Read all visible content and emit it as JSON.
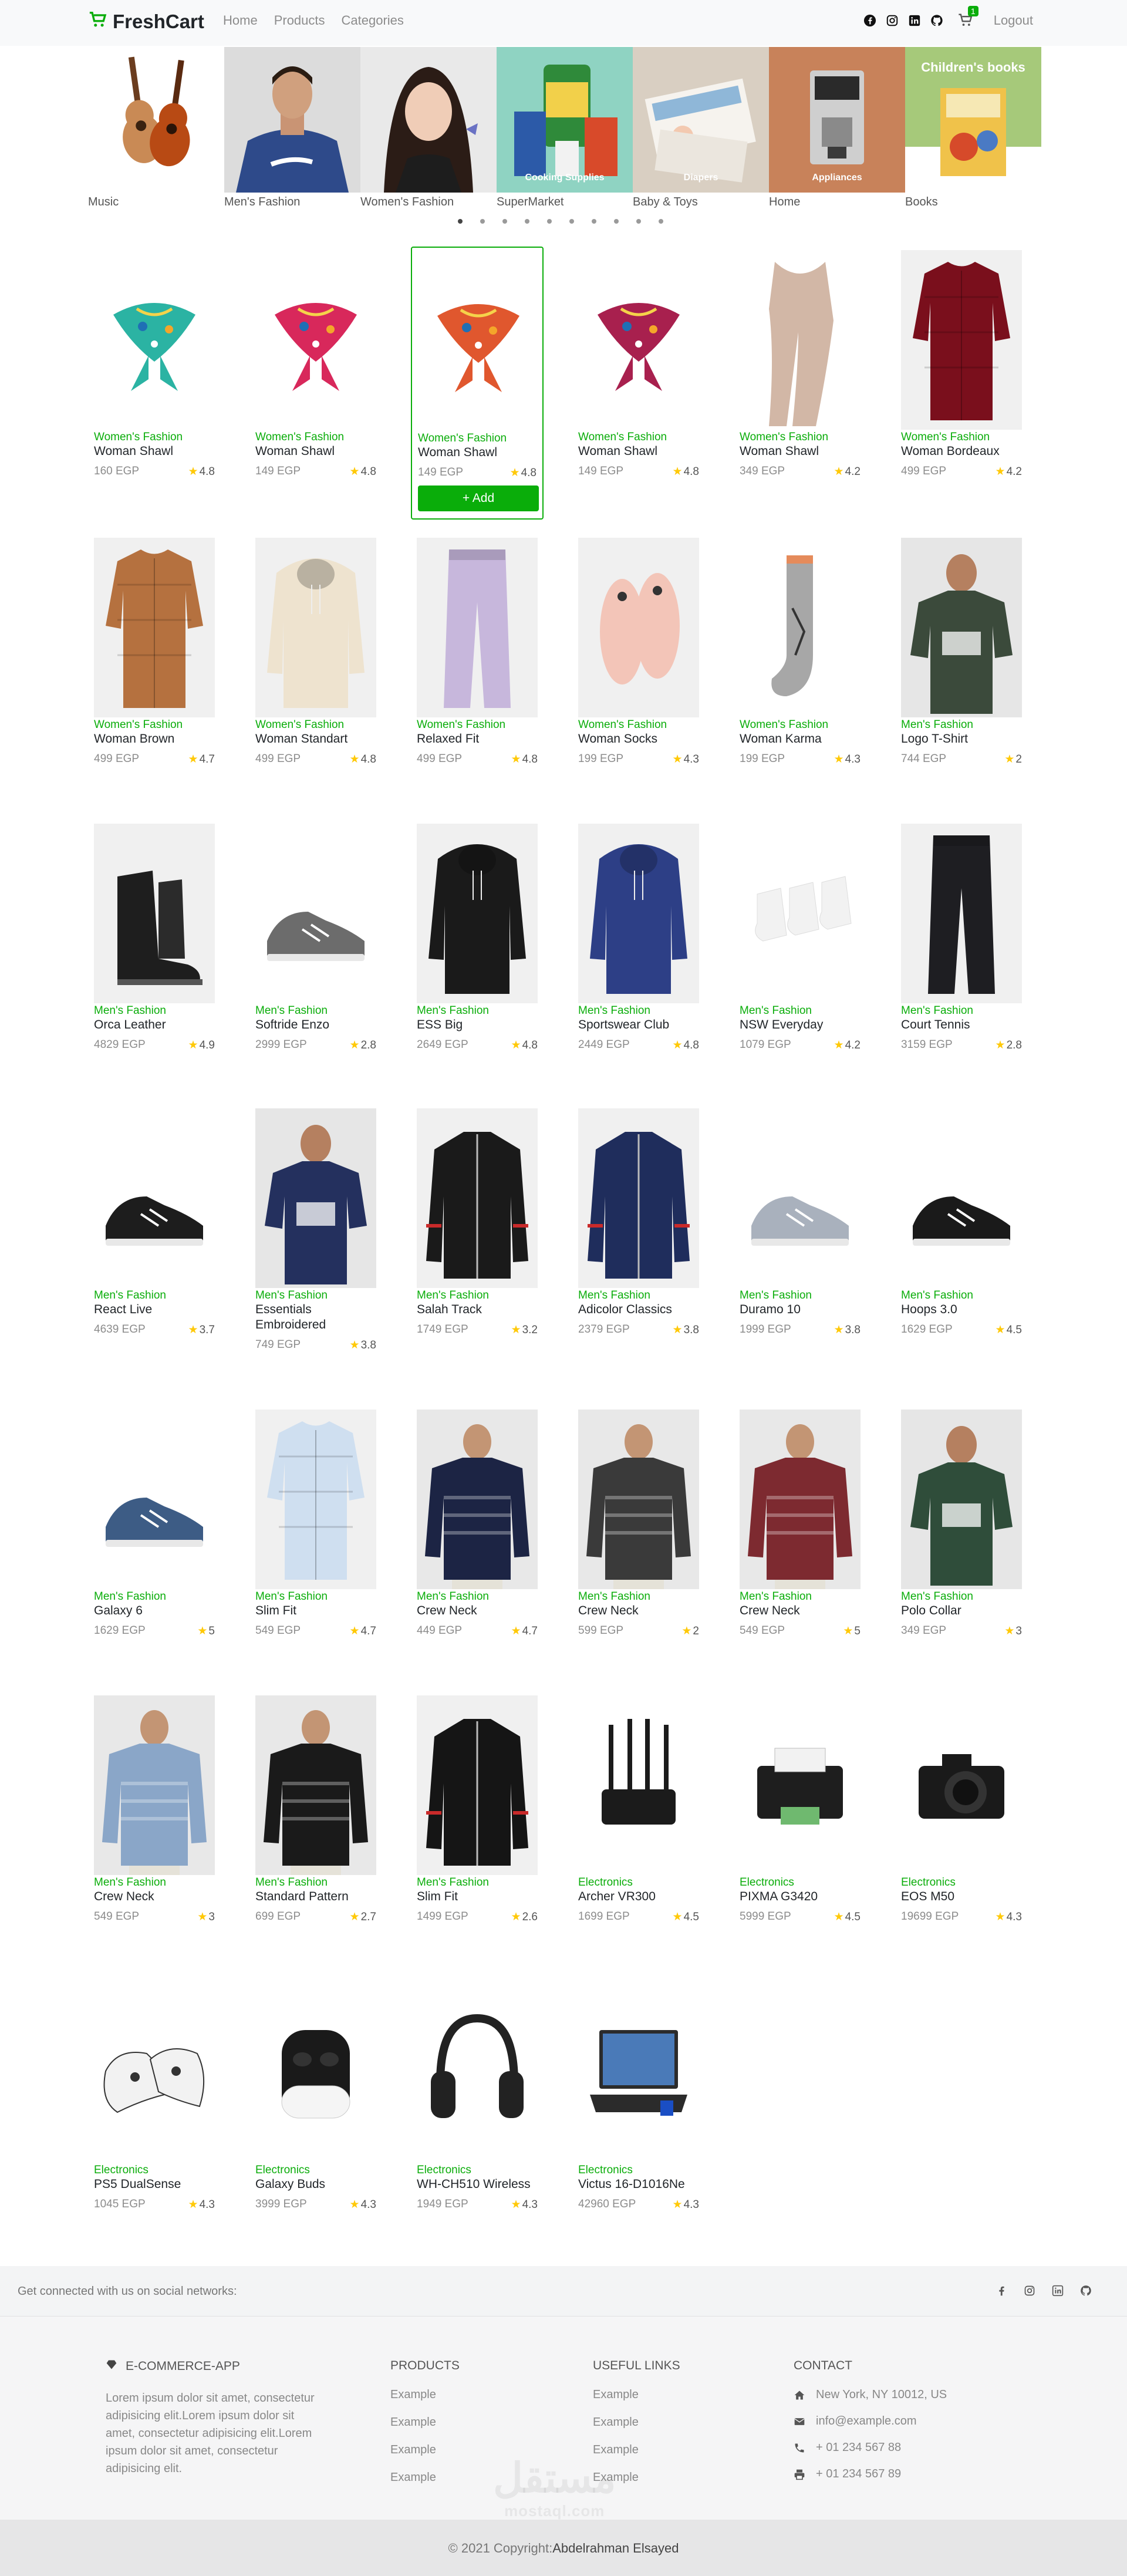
{
  "navbar": {
    "brand": "FreshCart",
    "links": [
      "Home",
      "Products",
      "Categories"
    ],
    "cart_count": "1",
    "logout": "Logout"
  },
  "slider": {
    "slides": [
      {
        "caption": "Music",
        "overlay": ""
      },
      {
        "caption": "Men's Fashion",
        "overlay": ""
      },
      {
        "caption": "Women's Fashion",
        "overlay": ""
      },
      {
        "caption": "SuperMarket",
        "overlay": "Cooking Supplies"
      },
      {
        "caption": "Baby & Toys",
        "overlay": "Diapers"
      },
      {
        "caption": "Home",
        "overlay": "Appliances"
      },
      {
        "caption": "Books",
        "overlay": "Children's books"
      }
    ],
    "dots": 10,
    "active_dot": 0
  },
  "add_label": "+ Add",
  "products": [
    {
      "category": "Women's Fashion",
      "title": "Woman Shawl",
      "price": "160 EGP",
      "rating": "4.8",
      "kind": "shawl",
      "color": "#2bb3a3"
    },
    {
      "category": "Women's Fashion",
      "title": "Woman Shawl",
      "price": "149 EGP",
      "rating": "4.8",
      "kind": "shawl",
      "color": "#d8285b"
    },
    {
      "category": "Women's Fashion",
      "title": "Woman Shawl",
      "price": "149 EGP",
      "rating": "4.8",
      "kind": "shawl",
      "color": "#e0572e"
    },
    {
      "category": "Women's Fashion",
      "title": "Woman Shawl",
      "price": "149 EGP",
      "rating": "4.8",
      "kind": "shawl",
      "color": "#a8204e"
    },
    {
      "category": "Women's Fashion",
      "title": "Woman Shawl",
      "price": "349 EGP",
      "rating": "4.2",
      "kind": "scarf",
      "color": "#d2b7a6"
    },
    {
      "category": "Women's Fashion",
      "title": "Woman Bordeaux",
      "price": "499 EGP",
      "rating": "4.2",
      "kind": "shirt",
      "color": "#7a0f1c"
    },
    {
      "category": "Women's Fashion",
      "title": "Woman Brown",
      "price": "499 EGP",
      "rating": "4.7",
      "kind": "shirt",
      "color": "#b5713f"
    },
    {
      "category": "Women's Fashion",
      "title": "Woman Standart",
      "price": "499 EGP",
      "rating": "4.8",
      "kind": "hoodie",
      "color": "#eee3cf"
    },
    {
      "category": "Women's Fashion",
      "title": "Relaxed Fit",
      "price": "499 EGP",
      "rating": "4.8",
      "kind": "pants",
      "color": "#c7b7dc"
    },
    {
      "category": "Women's Fashion",
      "title": "Woman Socks",
      "price": "199 EGP",
      "rating": "4.3",
      "kind": "slippers",
      "color": "#f3c5b8"
    },
    {
      "category": "Women's Fashion",
      "title": "Woman Karma",
      "price": "199 EGP",
      "rating": "4.3",
      "kind": "sock",
      "color": "#a7a7a7"
    },
    {
      "category": "Men's Fashion",
      "title": "Logo T-Shirt",
      "price": "744 EGP",
      "rating": "2",
      "kind": "tshirt",
      "color": "#3b4a3b"
    },
    {
      "category": "Men's Fashion",
      "title": "Orca Leather",
      "price": "4829 EGP",
      "rating": "4.9",
      "kind": "boot",
      "color": "#1e1e1e"
    },
    {
      "category": "Men's Fashion",
      "title": "Softride Enzo",
      "price": "2999 EGP",
      "rating": "2.8",
      "kind": "shoe",
      "color": "#6c6c6c"
    },
    {
      "category": "Men's Fashion",
      "title": "ESS Big",
      "price": "2649 EGP",
      "rating": "4.8",
      "kind": "hoodie",
      "color": "#1a1a1a"
    },
    {
      "category": "Men's Fashion",
      "title": "Sportswear Club",
      "price": "2449 EGP",
      "rating": "4.8",
      "kind": "hoodie",
      "color": "#2d3f86"
    },
    {
      "category": "Men's Fashion",
      "title": "NSW Everyday",
      "price": "1079 EGP",
      "rating": "4.2",
      "kind": "socks3",
      "color": "#f2f2f2"
    },
    {
      "category": "Men's Fashion",
      "title": "Court Tennis",
      "price": "3159 EGP",
      "rating": "2.8",
      "kind": "pants",
      "color": "#1e1e22"
    },
    {
      "category": "Men's Fashion",
      "title": "React Live",
      "price": "4639 EGP",
      "rating": "3.7",
      "kind": "shoe",
      "color": "#1d1d1d"
    },
    {
      "category": "Men's Fashion",
      "title": "Essentials Embroidered",
      "price": "749 EGP",
      "rating": "3.8",
      "kind": "tshirt",
      "color": "#24305e"
    },
    {
      "category": "Men's Fashion",
      "title": "Salah Track",
      "price": "1749 EGP",
      "rating": "3.2",
      "kind": "jacket",
      "color": "#1a1a1a"
    },
    {
      "category": "Men's Fashion",
      "title": "Adicolor Classics",
      "price": "2379 EGP",
      "rating": "3.8",
      "kind": "jacket",
      "color": "#1f2d5c"
    },
    {
      "category": "Men's Fashion",
      "title": "Duramo 10",
      "price": "1999 EGP",
      "rating": "3.8",
      "kind": "shoe",
      "color": "#a9b1bd"
    },
    {
      "category": "Men's Fashion",
      "title": "Hoops 3.0",
      "price": "1629 EGP",
      "rating": "4.5",
      "kind": "shoe",
      "color": "#1a1a1a"
    },
    {
      "category": "Men's Fashion",
      "title": "Galaxy 6",
      "price": "1629 EGP",
      "rating": "5",
      "kind": "shoe",
      "color": "#3d5c85"
    },
    {
      "category": "Men's Fashion",
      "title": "Slim Fit",
      "price": "549 EGP",
      "rating": "4.7",
      "kind": "shirt",
      "color": "#cfdff0"
    },
    {
      "category": "Men's Fashion",
      "title": "Crew Neck",
      "price": "449 EGP",
      "rating": "4.7",
      "kind": "sweater",
      "color": "#1c2444"
    },
    {
      "category": "Men's Fashion",
      "title": "Crew Neck",
      "price": "599 EGP",
      "rating": "2",
      "kind": "sweater",
      "color": "#3a3a3a"
    },
    {
      "category": "Men's Fashion",
      "title": "Crew Neck",
      "price": "549 EGP",
      "rating": "5",
      "kind": "sweater",
      "color": "#7d2a30"
    },
    {
      "category": "Men's Fashion",
      "title": "Polo Collar",
      "price": "349 EGP",
      "rating": "3",
      "kind": "tshirt",
      "color": "#2f4d3a"
    },
    {
      "category": "Men's Fashion",
      "title": "Crew Neck",
      "price": "549 EGP",
      "rating": "3",
      "kind": "sweater",
      "color": "#8aa6c8"
    },
    {
      "category": "Men's Fashion",
      "title": "Standard Pattern",
      "price": "699 EGP",
      "rating": "2.7",
      "kind": "sweater",
      "color": "#1a1a1a"
    },
    {
      "category": "Men's Fashion",
      "title": "Slim Fit",
      "price": "1499 EGP",
      "rating": "2.6",
      "kind": "jacket",
      "color": "#151515"
    },
    {
      "category": "Electronics",
      "title": "Archer VR300",
      "price": "1699 EGP",
      "rating": "4.5",
      "kind": "router",
      "color": "#1b1b1b"
    },
    {
      "category": "Electronics",
      "title": "PIXMA G3420",
      "price": "5999 EGP",
      "rating": "4.5",
      "kind": "printer",
      "color": "#1e1e1e"
    },
    {
      "category": "Electronics",
      "title": "EOS M50",
      "price": "19699 EGP",
      "rating": "4.3",
      "kind": "camera",
      "color": "#1a1a1a"
    },
    {
      "category": "Electronics",
      "title": "PS5 DualSense",
      "price": "1045 EGP",
      "rating": "4.3",
      "kind": "controllers",
      "color": "#f2f2f2"
    },
    {
      "category": "Electronics",
      "title": "Galaxy Buds",
      "price": "3999 EGP",
      "rating": "4.3",
      "kind": "buds",
      "color": "#1a1a1a"
    },
    {
      "category": "Electronics",
      "title": "WH-CH510 Wireless",
      "price": "1949 EGP",
      "rating": "4.3",
      "kind": "headphones",
      "color": "#222222"
    },
    {
      "category": "Electronics",
      "title": "Victus 16-D1016Ne",
      "price": "42960 EGP",
      "rating": "4.3",
      "kind": "laptop",
      "color": "#2b2b2b"
    }
  ],
  "footer": {
    "social_text": "Get connected with us on social networks:",
    "app_name": "E-COMMERCE-APP",
    "about": "Lorem ipsum dolor sit amet, consectetur adipisicing elit.Lorem ipsum dolor sit amet, consectetur adipisicing elit.Lorem ipsum dolor sit amet, consectetur adipisicing elit.",
    "products_head": "PRODUCTS",
    "products_links": [
      "Example",
      "Example",
      "Example",
      "Example"
    ],
    "useful_head": "USEFUL LINKS",
    "useful_links": [
      "Example",
      "Example",
      "Example",
      "Example"
    ],
    "contact_head": "CONTACT",
    "contact": {
      "address": "New York, NY 10012, US",
      "email": "info@example.com",
      "phone": "+ 01 234 567 88",
      "fax": "+ 01 234 567 89"
    },
    "copyright_prefix": "© 2021 Copyright:",
    "copyright_name": "Abdelrahman Elsayed",
    "watermark": "مستقل",
    "watermark_sub": "mostaql.com"
  },
  "colors": {
    "accent": "#0aad0a",
    "star": "#ffc908"
  }
}
